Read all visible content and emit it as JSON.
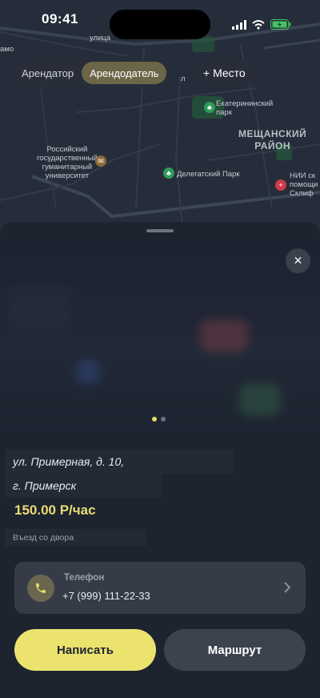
{
  "status_bar": {
    "time": "09:41"
  },
  "map": {
    "street_label": "улица",
    "edge_label": "амо",
    "university_label": "Российский\nгосударственный\nгуманитарный\nуниверситет",
    "park1_label": "Екатерининский\nпарк",
    "district_label": "МЕЩАНСКИЙ\nРАЙОН",
    "park2_label": "Делегатский Парк",
    "hospital_label": "НИИ ск\nпомощи\nСклиф",
    "partial_label": "л"
  },
  "segmented": {
    "items": [
      {
        "label": "Арендатор",
        "active": false
      },
      {
        "label": "Арендодатель",
        "active": true
      }
    ]
  },
  "add_place": {
    "label": "+ Место"
  },
  "sheet": {
    "close_glyph": "×",
    "address_line1": "ул. Примерная, д. 10,",
    "address_line2": "г. Примерск",
    "price": "150.00 Р/час",
    "note": "Въезд со двора",
    "phone": {
      "label": "Телефон",
      "number": "+7 (999) 111-22-33"
    },
    "primary_button": "Написать",
    "secondary_button": "Маршрут",
    "carousel": {
      "count": 2,
      "active_index": 0
    }
  },
  "colors": {
    "accent": "#ece26e",
    "sheet_bg": "#1d2430",
    "price": "#eadc73"
  }
}
